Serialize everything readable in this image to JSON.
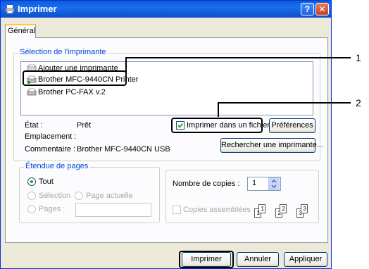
{
  "window": {
    "title": "Imprimer",
    "help_glyph": "?",
    "close_glyph": "✕"
  },
  "tabs": [
    {
      "label": "Général"
    }
  ],
  "printer_selection": {
    "group_label": "Sélection de l'imprimante",
    "printers": [
      {
        "label": "Ajouter une imprimante"
      },
      {
        "label": "Brother MFC-9440CN Printer"
      },
      {
        "label": "Brother PC-FAX v.2"
      }
    ],
    "status_label": "État :",
    "status_value": "Prêt",
    "location_label": "Emplacement :",
    "location_value": "",
    "comment_label": "Commentaire :",
    "comment_value": "Brother MFC-9440CN USB",
    "print_to_file_label": "Imprimer dans un fichier",
    "print_to_file_checked": true,
    "preferences_button": "Préférences",
    "find_printer_button": "Rechercher une imprimante..."
  },
  "page_range": {
    "group_label": "Étendue de pages",
    "options": [
      {
        "label": "Tout",
        "selected": true
      },
      {
        "label": "Sélection",
        "selected": false
      },
      {
        "label": "Page actuelle",
        "selected": false
      },
      {
        "label": "Pages :",
        "selected": false
      }
    ],
    "pages_value": ""
  },
  "copies": {
    "count_label": "Nombre de copies :",
    "count_value": "1",
    "collate_label": "Copies assemblées",
    "collate_checked": false,
    "collate_pages": [
      "1",
      "1",
      "2",
      "2",
      "3",
      "3"
    ]
  },
  "footer_buttons": {
    "print": "Imprimer",
    "cancel": "Annuler",
    "apply": "Appliquer"
  },
  "callouts": [
    "1",
    "2"
  ],
  "colors": {
    "titlebar": "#0a5fd8",
    "dialog_bg": "#ece9d8",
    "group_label": "#0046d5",
    "accent_tab": "#ffc83c"
  }
}
